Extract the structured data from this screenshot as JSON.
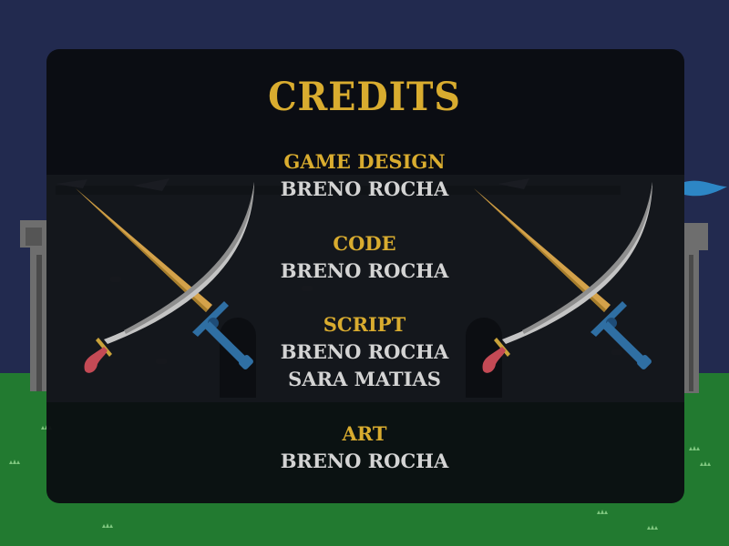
{
  "screen": "credits",
  "colors": {
    "sky": "#222a4f",
    "grass": "#227a30",
    "panel": "#0a0c10",
    "accent": "#d9ac2f",
    "text": "#d4d4d4"
  },
  "title": "CREDITS",
  "sections": [
    {
      "role": "GAME DESIGN",
      "names": [
        "BRENO ROCHA"
      ]
    },
    {
      "role": "CODE",
      "names": [
        "BRENO ROCHA"
      ]
    },
    {
      "role": "SCRIPT",
      "names": [
        "BRENO ROCHA",
        "SARA MATIAS"
      ]
    },
    {
      "role": "ART",
      "names": [
        "BRENO ROCHA"
      ]
    }
  ],
  "decorations": {
    "left_swords": [
      "broadsword-icon",
      "scimitar-icon"
    ],
    "right_swords": [
      "broadsword-icon",
      "scimitar-icon"
    ],
    "background": [
      "castle-wall",
      "tower",
      "banner-flag",
      "grass-field"
    ]
  }
}
